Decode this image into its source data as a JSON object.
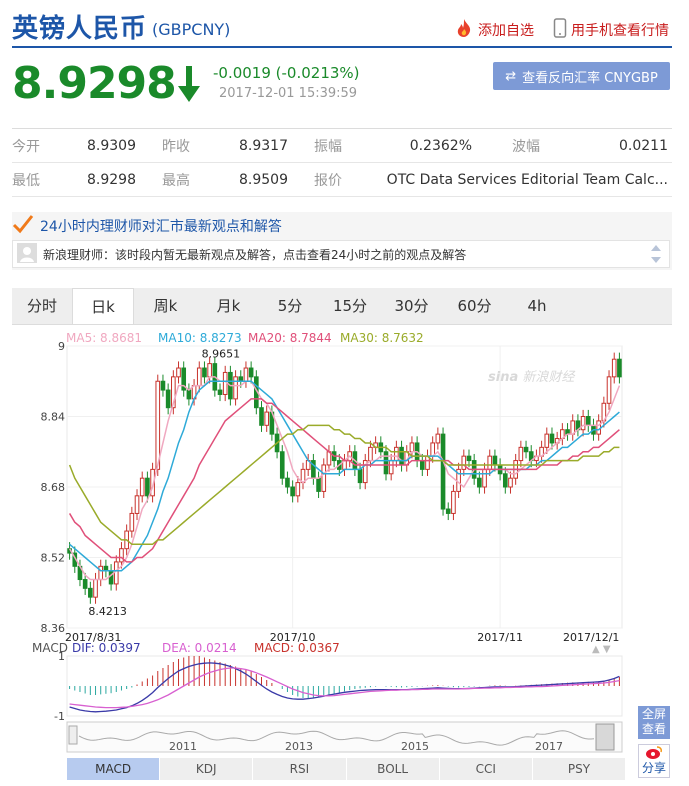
{
  "header": {
    "title": "英镑人民币",
    "code": "(GBPCNY)",
    "add_favorite": "添加自选",
    "mobile_view": "用手机查看行情"
  },
  "quote": {
    "price": "8.9298",
    "change": "-0.0019 (-0.0213%)",
    "time": "2017-12-01 15:39:59",
    "reverse_button": "查看反向汇率 CNYGBP"
  },
  "stats": [
    [
      {
        "label": "今开",
        "value": "8.9309"
      },
      {
        "label": "昨收",
        "value": "8.9317"
      },
      {
        "label": "振幅",
        "value": "0.2362%"
      },
      {
        "label": "波幅",
        "value": "0.0211"
      }
    ],
    [
      {
        "label": "最低",
        "value": "8.9298"
      },
      {
        "label": "最高",
        "value": "8.9509"
      },
      {
        "label": "报价",
        "value": ""
      },
      {
        "label": "",
        "value": "OTC Data Services Editorial Team Calc..."
      }
    ]
  ],
  "advisor": {
    "title": "24小时内理财师对汇市最新观点和解答",
    "message": "新浪理财师：该时段内暂无最新观点及解答，点击查看24小时之前的观点及解答"
  },
  "tabs": [
    "分时",
    "日k",
    "周k",
    "月k",
    "5分",
    "15分",
    "30分",
    "60分",
    "4h"
  ],
  "active_tab": "日k",
  "watermark": "新浪财经",
  "ma_labels": [
    {
      "text": "MA5: 8.8681",
      "color": "#f0a8c0"
    },
    {
      "text": "MA10: 8.8273",
      "color": "#2eaad8"
    },
    {
      "text": "MA20: 8.7844",
      "color": "#e0507a"
    },
    {
      "text": "MA30: 8.7632",
      "color": "#9aab2a"
    }
  ],
  "macd_labels": {
    "name": "MACD",
    "dif": "DIF: 0.0397",
    "dea": "DEA: 0.0214",
    "macd": "MACD: 0.0367"
  },
  "indicator_tabs": [
    "MACD",
    "KDJ",
    "RSI",
    "BOLL",
    "CCI",
    "PSY"
  ],
  "active_indicator": "MACD",
  "side_buttons": {
    "fullscreen": "全屏查看",
    "share": "分享"
  },
  "range_labels": [
    "2011",
    "2013",
    "2015",
    "2017"
  ],
  "colors": {
    "up": "#c8322c",
    "down": "#1a8a2a",
    "brand": "#1d56a8",
    "dif": "#3a3aa8",
    "dea": "#d860d0"
  },
  "chart_data": {
    "type": "candlestick",
    "title": "",
    "y_ticks": [
      "9",
      "8.84",
      "8.68",
      "8.52",
      "8.36"
    ],
    "ylim": [
      8.36,
      9.0
    ],
    "x_labels": [
      "2017/8/31",
      "2017/10",
      "2017/11",
      "2017/12/1"
    ],
    "annotations": [
      {
        "text": "8.9651",
        "value": 8.9651
      },
      {
        "text": "8.4213",
        "value": 8.4213
      }
    ],
    "candles_close": [
      8.53,
      8.5,
      8.47,
      8.45,
      8.43,
      8.47,
      8.5,
      8.49,
      8.46,
      8.51,
      8.54,
      8.58,
      8.62,
      8.66,
      8.7,
      8.66,
      8.72,
      8.92,
      8.9,
      8.86,
      8.93,
      8.95,
      8.9,
      8.88,
      8.91,
      8.95,
      8.93,
      8.96,
      8.9,
      8.89,
      8.94,
      8.88,
      8.93,
      8.92,
      8.95,
      8.93,
      8.86,
      8.82,
      8.85,
      8.8,
      8.76,
      8.7,
      8.68,
      8.66,
      8.69,
      8.72,
      8.74,
      8.7,
      8.67,
      8.73,
      8.76,
      8.74,
      8.72,
      8.74,
      8.76,
      8.72,
      8.69,
      8.74,
      8.77,
      8.78,
      8.76,
      8.71,
      8.74,
      8.77,
      8.73,
      8.76,
      8.78,
      8.74,
      8.72,
      8.75,
      8.78,
      8.8,
      8.63,
      8.62,
      8.67,
      8.72,
      8.75,
      8.74,
      8.7,
      8.68,
      8.72,
      8.75,
      8.73,
      8.71,
      8.68,
      8.7,
      8.74,
      8.77,
      8.76,
      8.74,
      8.75,
      8.77,
      8.8,
      8.78,
      8.79,
      8.81,
      8.8,
      8.83,
      8.81,
      8.84,
      8.82,
      8.8,
      8.83,
      8.87,
      8.93,
      8.97,
      8.93
    ],
    "ma5": [
      8.54,
      8.52,
      8.5,
      8.48,
      8.47,
      8.47,
      8.47,
      8.47,
      8.48,
      8.49,
      8.5,
      8.52,
      8.55,
      8.59,
      8.63,
      8.65,
      8.68,
      8.73,
      8.78,
      8.83,
      8.87,
      8.91,
      8.91,
      8.9,
      8.91,
      8.91,
      8.91,
      8.93,
      8.93,
      8.92,
      8.92,
      8.91,
      8.91,
      8.91,
      8.92,
      8.92,
      8.9,
      8.88,
      8.87,
      8.85,
      8.82,
      8.79,
      8.76,
      8.72,
      8.7,
      8.69,
      8.7,
      8.7,
      8.7,
      8.71,
      8.72,
      8.72,
      8.73,
      8.74,
      8.75,
      8.74,
      8.73,
      8.73,
      8.74,
      8.74,
      8.75,
      8.75,
      8.75,
      8.75,
      8.74,
      8.74,
      8.76,
      8.76,
      8.75,
      8.75,
      8.75,
      8.76,
      8.74,
      8.71,
      8.7,
      8.69,
      8.68,
      8.7,
      8.72,
      8.72,
      8.72,
      8.72,
      8.72,
      8.72,
      8.72,
      8.71,
      8.71,
      8.72,
      8.73,
      8.74,
      8.75,
      8.75,
      8.76,
      8.77,
      8.78,
      8.79,
      8.8,
      8.8,
      8.81,
      8.82,
      8.82,
      8.82,
      8.82,
      8.83,
      8.85,
      8.88,
      8.91
    ],
    "ma10": [
      8.55,
      8.54,
      8.53,
      8.52,
      8.51,
      8.5,
      8.49,
      8.49,
      8.49,
      8.49,
      8.49,
      8.5,
      8.51,
      8.53,
      8.55,
      8.57,
      8.6,
      8.63,
      8.67,
      8.7,
      8.74,
      8.78,
      8.81,
      8.85,
      8.88,
      8.9,
      8.91,
      8.92,
      8.92,
      8.92,
      8.92,
      8.92,
      8.92,
      8.92,
      8.92,
      8.92,
      8.91,
      8.9,
      8.89,
      8.88,
      8.86,
      8.84,
      8.82,
      8.8,
      8.78,
      8.76,
      8.74,
      8.73,
      8.72,
      8.71,
      8.71,
      8.71,
      8.71,
      8.72,
      8.72,
      8.72,
      8.72,
      8.73,
      8.73,
      8.74,
      8.74,
      8.74,
      8.74,
      8.74,
      8.74,
      8.74,
      8.75,
      8.75,
      8.75,
      8.75,
      8.75,
      8.75,
      8.74,
      8.73,
      8.72,
      8.71,
      8.71,
      8.71,
      8.71,
      8.71,
      8.71,
      8.71,
      8.72,
      8.72,
      8.72,
      8.72,
      8.72,
      8.72,
      8.72,
      8.73,
      8.73,
      8.74,
      8.74,
      8.75,
      8.76,
      8.77,
      8.77,
      8.78,
      8.79,
      8.8,
      8.8,
      8.81,
      8.81,
      8.82,
      8.83,
      8.84,
      8.85
    ],
    "ma20": [
      8.62,
      8.6,
      8.59,
      8.57,
      8.56,
      8.55,
      8.54,
      8.53,
      8.52,
      8.52,
      8.52,
      8.51,
      8.51,
      8.52,
      8.52,
      8.53,
      8.54,
      8.56,
      8.58,
      8.6,
      8.62,
      8.64,
      8.66,
      8.68,
      8.7,
      8.73,
      8.75,
      8.77,
      8.79,
      8.81,
      8.83,
      8.84,
      8.85,
      8.86,
      8.87,
      8.88,
      8.88,
      8.88,
      8.87,
      8.87,
      8.86,
      8.85,
      8.84,
      8.83,
      8.82,
      8.81,
      8.8,
      8.79,
      8.78,
      8.77,
      8.76,
      8.75,
      8.75,
      8.74,
      8.74,
      8.73,
      8.73,
      8.73,
      8.73,
      8.73,
      8.73,
      8.73,
      8.73,
      8.73,
      8.73,
      8.73,
      8.74,
      8.74,
      8.74,
      8.74,
      8.74,
      8.74,
      8.74,
      8.74,
      8.73,
      8.73,
      8.73,
      8.72,
      8.72,
      8.72,
      8.72,
      8.72,
      8.72,
      8.72,
      8.72,
      8.72,
      8.72,
      8.72,
      8.72,
      8.72,
      8.72,
      8.73,
      8.73,
      8.73,
      8.73,
      8.74,
      8.74,
      8.75,
      8.75,
      8.76,
      8.76,
      8.77,
      8.77,
      8.78,
      8.79,
      8.8,
      8.81
    ],
    "ma30": [
      8.73,
      8.7,
      8.68,
      8.66,
      8.64,
      8.62,
      8.6,
      8.59,
      8.58,
      8.57,
      8.56,
      8.56,
      8.55,
      8.55,
      8.55,
      8.55,
      8.55,
      8.56,
      8.56,
      8.57,
      8.58,
      8.59,
      8.6,
      8.61,
      8.62,
      8.63,
      8.64,
      8.65,
      8.66,
      8.67,
      8.68,
      8.69,
      8.7,
      8.71,
      8.72,
      8.73,
      8.74,
      8.75,
      8.76,
      8.77,
      8.78,
      8.79,
      8.8,
      8.8,
      8.81,
      8.81,
      8.82,
      8.82,
      8.82,
      8.82,
      8.82,
      8.81,
      8.81,
      8.8,
      8.8,
      8.79,
      8.79,
      8.78,
      8.78,
      8.77,
      8.77,
      8.77,
      8.76,
      8.76,
      8.76,
      8.76,
      8.75,
      8.75,
      8.75,
      8.75,
      8.74,
      8.74,
      8.74,
      8.73,
      8.73,
      8.73,
      8.73,
      8.73,
      8.73,
      8.73,
      8.73,
      8.73,
      8.73,
      8.73,
      8.73,
      8.73,
      8.73,
      8.73,
      8.73,
      8.73,
      8.73,
      8.73,
      8.74,
      8.74,
      8.74,
      8.74,
      8.74,
      8.74,
      8.74,
      8.75,
      8.75,
      8.75,
      8.75,
      8.76,
      8.76,
      8.77,
      8.77
    ],
    "macd_ylim": [
      -1,
      1
    ],
    "macd_ticks": [
      "1",
      "-1"
    ],
    "macd_hist": [
      -0.1,
      -0.15,
      -0.2,
      -0.25,
      -0.3,
      -0.3,
      -0.28,
      -0.26,
      -0.24,
      -0.2,
      -0.15,
      -0.1,
      -0.05,
      0.05,
      0.15,
      0.25,
      0.35,
      0.5,
      0.6,
      0.7,
      0.8,
      0.9,
      0.95,
      1.0,
      1.0,
      1.0,
      0.95,
      0.9,
      0.85,
      0.8,
      0.75,
      0.7,
      0.65,
      0.6,
      0.55,
      0.5,
      0.4,
      0.3,
      0.2,
      0.1,
      0.0,
      -0.1,
      -0.2,
      -0.3,
      -0.35,
      -0.4,
      -0.42,
      -0.4,
      -0.38,
      -0.35,
      -0.3,
      -0.26,
      -0.22,
      -0.18,
      -0.14,
      -0.1,
      -0.08,
      -0.06,
      -0.04,
      -0.02,
      0.0,
      -0.02,
      -0.03,
      -0.04,
      -0.05,
      -0.04,
      -0.03,
      -0.02,
      -0.01,
      0.01,
      0.02,
      0.03,
      0.01,
      -0.02,
      -0.04,
      -0.05,
      -0.04,
      -0.03,
      -0.02,
      -0.01,
      0.0,
      0.01,
      0.02,
      0.02,
      0.01,
      0.0,
      0.01,
      0.02,
      0.03,
      0.04,
      0.05,
      0.06,
      0.07,
      0.08,
      0.09,
      0.1,
      0.11,
      0.12,
      0.12,
      0.13,
      0.14,
      0.15,
      0.16,
      0.18,
      0.22,
      0.26,
      0.3
    ],
    "macd_dif": [
      -0.7,
      -0.75,
      -0.8,
      -0.83,
      -0.85,
      -0.86,
      -0.85,
      -0.84,
      -0.82,
      -0.8,
      -0.76,
      -0.72,
      -0.66,
      -0.58,
      -0.48,
      -0.36,
      -0.22,
      -0.05,
      0.1,
      0.25,
      0.38,
      0.5,
      0.58,
      0.65,
      0.7,
      0.74,
      0.76,
      0.77,
      0.76,
      0.74,
      0.7,
      0.65,
      0.58,
      0.5,
      0.4,
      0.28,
      0.15,
      0.02,
      -0.1,
      -0.2,
      -0.28,
      -0.35,
      -0.4,
      -0.43,
      -0.44,
      -0.44,
      -0.42,
      -0.4,
      -0.37,
      -0.34,
      -0.3,
      -0.27,
      -0.24,
      -0.21,
      -0.19,
      -0.17,
      -0.15,
      -0.14,
      -0.13,
      -0.12,
      -0.12,
      -0.12,
      -0.12,
      -0.12,
      -0.12,
      -0.12,
      -0.11,
      -0.1,
      -0.09,
      -0.08,
      -0.07,
      -0.06,
      -0.07,
      -0.08,
      -0.09,
      -0.09,
      -0.09,
      -0.08,
      -0.07,
      -0.06,
      -0.05,
      -0.04,
      -0.03,
      -0.03,
      -0.03,
      -0.03,
      -0.02,
      -0.01,
      0.0,
      0.01,
      0.02,
      0.03,
      0.04,
      0.05,
      0.06,
      0.07,
      0.08,
      0.09,
      0.1,
      0.11,
      0.12,
      0.13,
      0.14,
      0.16,
      0.2,
      0.25,
      0.32
    ],
    "macd_dea": [
      -0.6,
      -0.62,
      -0.64,
      -0.66,
      -0.68,
      -0.7,
      -0.71,
      -0.72,
      -0.72,
      -0.72,
      -0.71,
      -0.7,
      -0.68,
      -0.65,
      -0.62,
      -0.58,
      -0.52,
      -0.46,
      -0.38,
      -0.3,
      -0.2,
      -0.1,
      0.0,
      0.1,
      0.2,
      0.3,
      0.38,
      0.45,
      0.5,
      0.55,
      0.58,
      0.6,
      0.6,
      0.58,
      0.55,
      0.5,
      0.44,
      0.37,
      0.3,
      0.22,
      0.14,
      0.06,
      -0.02,
      -0.1,
      -0.16,
      -0.22,
      -0.26,
      -0.3,
      -0.32,
      -0.33,
      -0.33,
      -0.32,
      -0.3,
      -0.28,
      -0.26,
      -0.24,
      -0.22,
      -0.2,
      -0.18,
      -0.17,
      -0.16,
      -0.15,
      -0.14,
      -0.14,
      -0.13,
      -0.13,
      -0.12,
      -0.12,
      -0.11,
      -0.11,
      -0.1,
      -0.1,
      -0.1,
      -0.1,
      -0.1,
      -0.1,
      -0.09,
      -0.09,
      -0.08,
      -0.08,
      -0.07,
      -0.07,
      -0.06,
      -0.06,
      -0.05,
      -0.05,
      -0.04,
      -0.04,
      -0.03,
      -0.03,
      -0.02,
      -0.02,
      -0.01,
      0.0,
      0.01,
      0.02,
      0.03,
      0.04,
      0.05,
      0.06,
      0.07,
      0.08,
      0.09,
      0.1,
      0.12,
      0.15,
      0.18
    ]
  }
}
